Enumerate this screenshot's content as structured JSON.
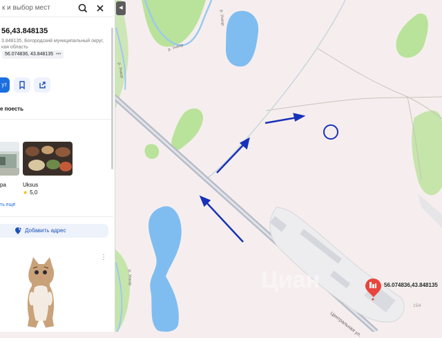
{
  "search": {
    "text": "к и выбор мест"
  },
  "place": {
    "title": "56,43.848135",
    "address_line1": "3.848135, Богородский муниципальный округ,",
    "address_line2": "кая область",
    "coords_chip": "56.074836, 43.848135"
  },
  "actions": {
    "route_label": "ут"
  },
  "nearby": {
    "title": "е поесть",
    "cards": [
      {
        "name": "ра",
        "thumb": "cafe-photo"
      },
      {
        "name": "Uksus",
        "rating": "5,0",
        "thumb": "food-photo"
      }
    ],
    "more": "ть ещё"
  },
  "add_address": {
    "label": "Добавить адрес",
    "icon": "add-location-icon"
  },
  "map": {
    "marker_label": "56.074836,43.848135",
    "street_label": "Центральная ул.",
    "river_label": "р. Ункор",
    "house_number": "15/4",
    "watermark": "Циан",
    "colors": {
      "background": "#f6eeee",
      "water": "#7fbdf0",
      "park": "#b9e29a",
      "road": "#b7bcc8",
      "arrow": "#1732b8",
      "marker": "#e8453c",
      "accent": "#1d6fe0"
    }
  }
}
